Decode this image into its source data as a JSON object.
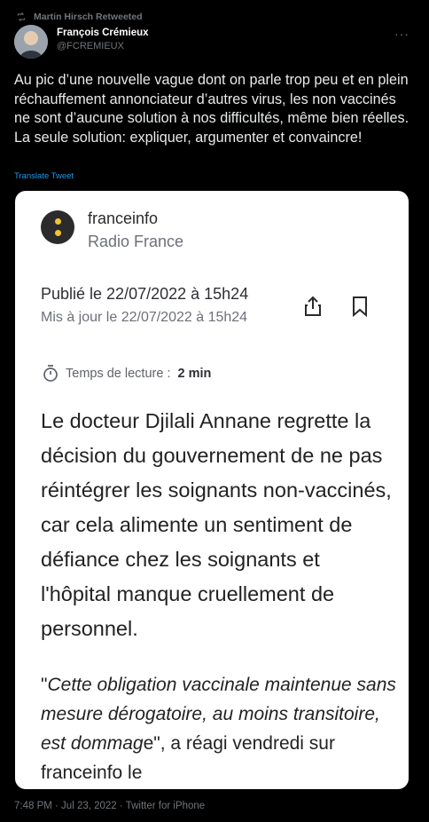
{
  "retweet": {
    "label": "Martin Hirsch Retweeted"
  },
  "author": {
    "name": "François Crémieux",
    "handle": "@FCREMIEUX"
  },
  "tweet": {
    "text": "Au pic d’une nouvelle vague dont on parle trop peu et en plein réchauffement annonciateur d’autres virus, les non vaccinés ne sont d’aucune solution à nos difficultés, même bien réelles. La seule solution: expliquer, argumenter et convaincre!",
    "translate_label": "Translate Tweet"
  },
  "card": {
    "brand_name": "franceinfo",
    "brand_sub": "Radio France",
    "published": "Publié le 22/07/2022 à 15h24",
    "updated": "Mis à jour le 22/07/2022 à 15h24",
    "reading_prefix": "Temps de lecture : ",
    "reading_value": "2 min",
    "lead": "Le docteur Djilali Annane regrette la décision du gouvernement de ne pas réintégrer les soignants non-vaccinés, car cela alimente un sentiment de défiance chez les soignants et l'hôpital manque cruellement de personnel.",
    "quote_open": "\"",
    "quote_italic": "Cette obligation vaccinale maintenue sans mesure dérogatoire, au moins transitoire, est dommag",
    "quote_rest": "e\", a réagi vendredi sur franceinfo le"
  },
  "footer": {
    "timestamp": "7:48 PM · Jul 23, 2022 · Twitter for iPhone"
  },
  "colors": {
    "link": "#1d9bf0",
    "secondary": "#71767b",
    "logo_dots": "#f4c430"
  },
  "icons": [
    "retweet-icon",
    "more-icon",
    "share-icon",
    "bookmark-icon",
    "timer-icon"
  ]
}
